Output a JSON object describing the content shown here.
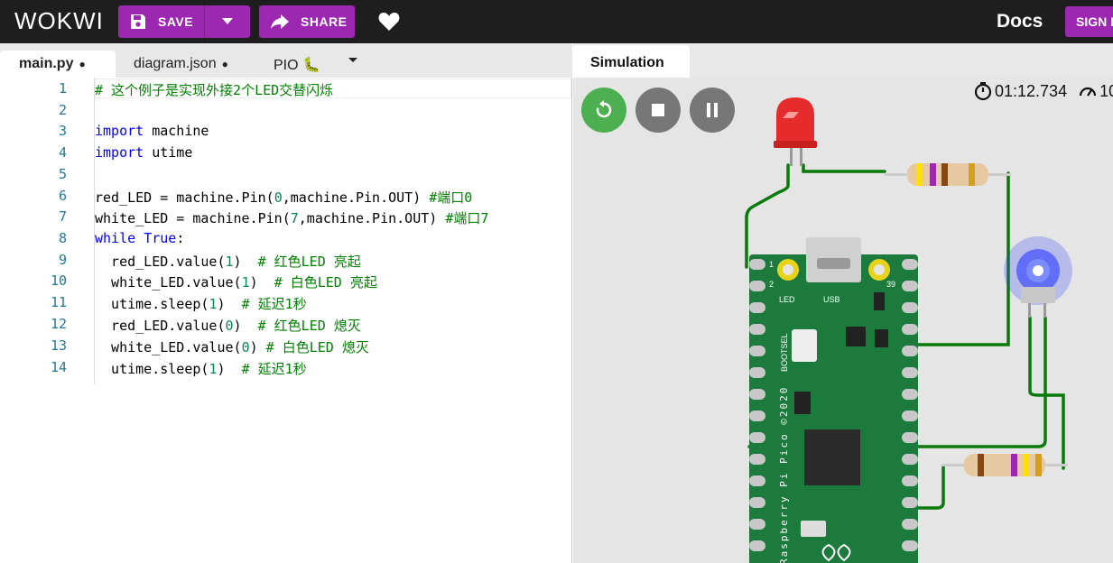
{
  "header": {
    "logo": "WOKWI",
    "save_label": "SAVE",
    "share_label": "SHARE",
    "docs_label": "Docs",
    "signin_label": "SIGN I"
  },
  "editor": {
    "tabs": [
      {
        "label": "main.py",
        "modified": "●"
      },
      {
        "label": "diagram.json",
        "modified": "●"
      },
      {
        "label": "PIO 🐛"
      }
    ],
    "lines": [
      {
        "num": "1",
        "text": "# 这个例子是实现外接2个LED交替闪烁"
      },
      {
        "num": "2",
        "text": ""
      },
      {
        "num": "3",
        "text": "import machine"
      },
      {
        "num": "4",
        "text": "import utime"
      },
      {
        "num": "5",
        "text": ""
      },
      {
        "num": "6",
        "text": "red_LED = machine.Pin(0,machine.Pin.OUT) #端口0"
      },
      {
        "num": "7",
        "text": "white_LED = machine.Pin(7,machine.Pin.OUT) #端口7"
      },
      {
        "num": "8",
        "text": "while True:"
      },
      {
        "num": "9",
        "text": "  red_LED.value(1)  # 红色LED 亮起"
      },
      {
        "num": "10",
        "text": "  white_LED.value(1)  # 白色LED 亮起"
      },
      {
        "num": "11",
        "text": "  utime.sleep(1)  # 延迟1秒"
      },
      {
        "num": "12",
        "text": "  red_LED.value(0)  # 红色LED 熄灭"
      },
      {
        "num": "13",
        "text": "  white_LED.value(0) # 白色LED 熄灭"
      },
      {
        "num": "14",
        "text": "  utime.sleep(1)  # 延迟1秒"
      }
    ]
  },
  "simulation": {
    "tab_label": "Simulation",
    "timer": "01:12.734",
    "speed": "10",
    "board": {
      "pin1": "1",
      "pin2": "2",
      "pin39": "39",
      "led_label": "LED",
      "usb_label": "USB",
      "bootsel_label": "BOOTSEL",
      "name_label": "Raspberry Pi Pico ©2020"
    }
  },
  "colors": {
    "accent": "#9c27b0",
    "board": "#1b7a3c",
    "wire": "#0a7a0a",
    "pad": "#e8d21a"
  }
}
